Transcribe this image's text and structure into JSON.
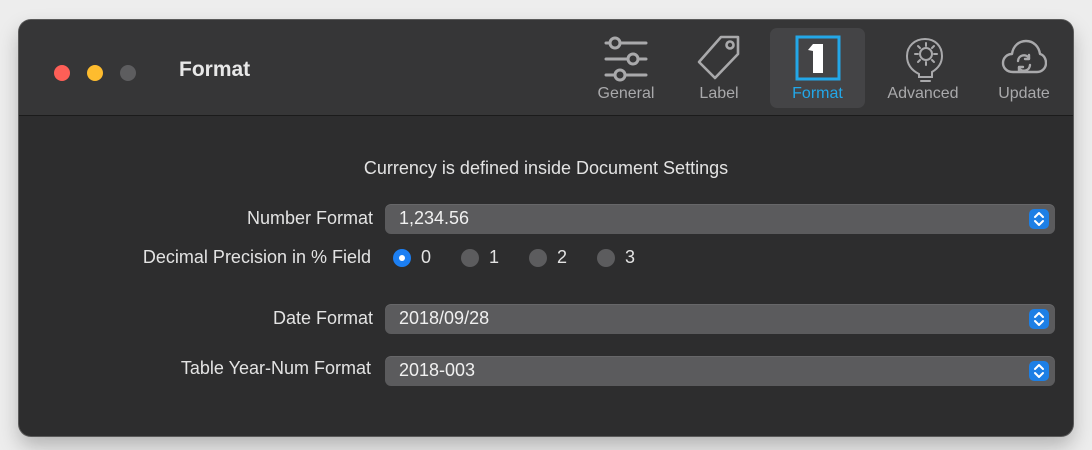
{
  "window": {
    "title": "Format"
  },
  "toolbar": {
    "items": [
      {
        "label": "General",
        "icon": "sliders-icon"
      },
      {
        "label": "Label",
        "icon": "tag-icon"
      },
      {
        "label": "Format",
        "icon": "number-one-box-icon",
        "selected": true
      },
      {
        "label": "Advanced",
        "icon": "gear-lightbulb-icon"
      },
      {
        "label": "Update",
        "icon": "cloud-sync-icon"
      }
    ]
  },
  "content": {
    "notice": "Currency is defined inside  Document Settings",
    "number_format": {
      "label": "Number Format",
      "value": "1,234.56"
    },
    "decimal_precision": {
      "label": "Decimal Precision in % Field",
      "options": [
        "0",
        "1",
        "2",
        "3"
      ],
      "selected": "0"
    },
    "date_format": {
      "label": "Date Format",
      "value": "2018/09/28"
    },
    "year_num_format": {
      "label": "Table Year-Num Format",
      "value": "2018-003"
    }
  },
  "colors": {
    "accent": "#1c7ff3",
    "selected_tab_text": "#23a7e8",
    "close": "#fe5f57",
    "minimize": "#febc2e"
  }
}
